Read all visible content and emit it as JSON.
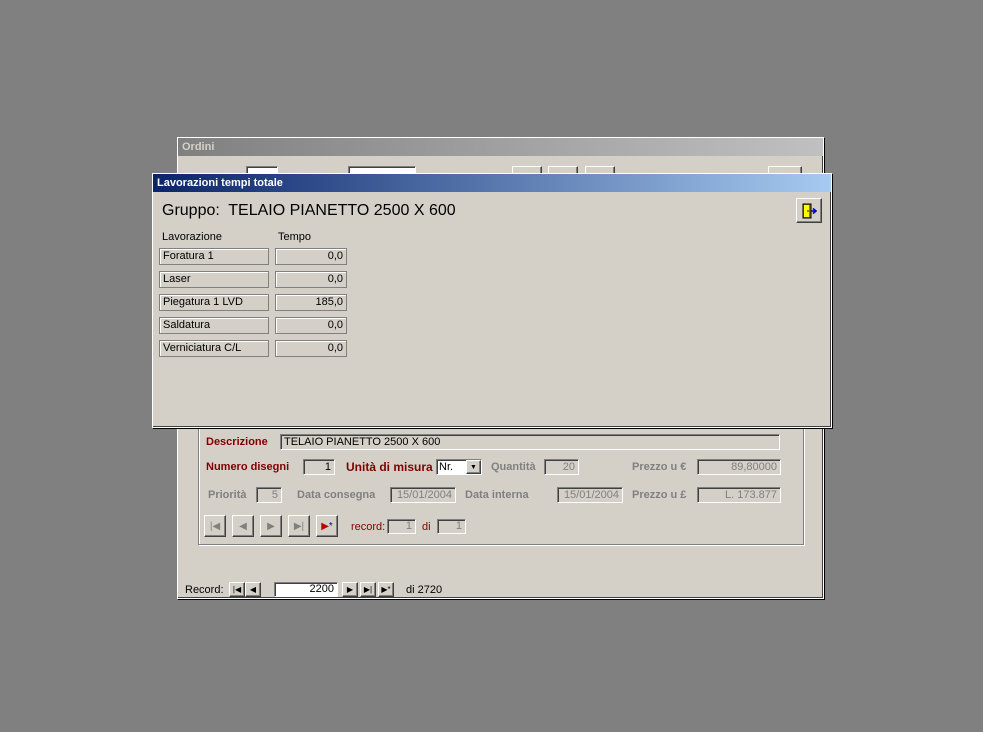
{
  "ordini": {
    "title": "Ordini",
    "descrizione_label": "Descrizione",
    "descrizione_value": "TELAIO PIANETTO 2500 X 600",
    "numero_disegni_label": "Numero disegni",
    "numero_disegni_value": "1",
    "unita_label": "Unità di misura",
    "unita_value": "Nr.",
    "quantita_label": "Quantità",
    "quantita_value": "20",
    "prezzo_eur_label": "Prezzo u €",
    "prezzo_eur_value": "89,80000",
    "priorita_label": "Priorità",
    "priorita_value": "5",
    "data_consegna_label": "Data consegna",
    "data_consegna_value": "15/01/2004",
    "data_interna_label": "Data interna",
    "data_interna_value": "15/01/2004",
    "prezzo_lire_label": "Prezzo u £",
    "prezzo_lire_value": "L. 173.877",
    "subrecord_label": "record:",
    "subrecord_value": "1",
    "subrecord_of_label": "di",
    "subrecord_total": "1",
    "record_label": "Record:",
    "record_value": "2200",
    "record_total": "di 2720"
  },
  "lavorazioni": {
    "title": "Lavorazioni tempi totale",
    "gruppo_label": "Gruppo:",
    "gruppo_value": "TELAIO PIANETTO 2500 X 600",
    "col_lavorazione": "Lavorazione",
    "col_tempo": "Tempo",
    "rows": [
      {
        "name": "Foratura 1",
        "tempo": "0,0"
      },
      {
        "name": "Laser",
        "tempo": "0,0"
      },
      {
        "name": "Piegatura 1 LVD",
        "tempo": "185,0"
      },
      {
        "name": "Saldatura",
        "tempo": "0,0"
      },
      {
        "name": "Verniciatura C/L",
        "tempo": "0,0"
      }
    ]
  },
  "icons": {
    "exit": "exit-door-icon",
    "first": "first-record-icon",
    "prev": "prev-record-icon",
    "next": "next-record-icon",
    "last": "last-record-icon",
    "new": "new-record-icon"
  },
  "colors": {
    "desktop": "#808080",
    "window": "#d4d0c8",
    "active_title_start": "#0a246a",
    "active_title_end": "#a6caf0",
    "label_red": "#800000"
  }
}
